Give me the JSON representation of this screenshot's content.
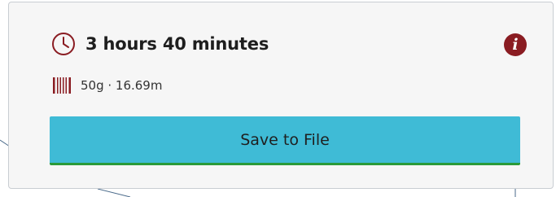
{
  "print_info": {
    "estimated_time": "3 hours 40 minutes",
    "material_usage": "50g · 16.69m"
  },
  "actions": {
    "save_label": "Save to File"
  },
  "icons": {
    "time": "clock-icon",
    "info": "info-icon",
    "material": "filament-spool-icon"
  },
  "colors": {
    "accent_red": "#8a1c22",
    "button_blue": "#3fbbd6",
    "button_border": "#2a9a3a",
    "panel_bg": "#f6f6f6"
  }
}
